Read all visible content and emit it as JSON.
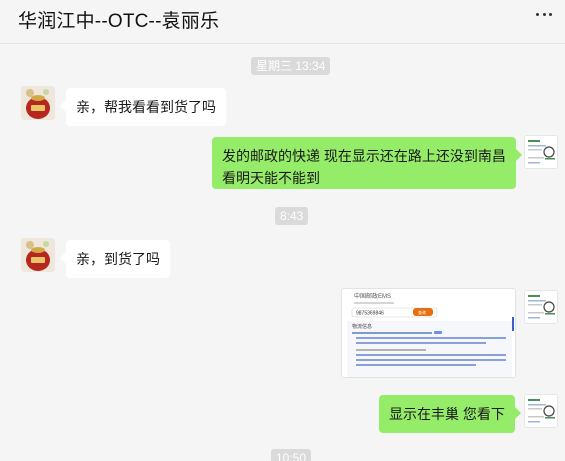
{
  "chat": {
    "title": "华润江中--OTC--袁丽乐"
  },
  "timestamps": [
    "星期三 13:34",
    "8:43",
    "10:50"
  ],
  "messages": [
    {
      "side": "in",
      "text": "亲，帮我看看到货了吗"
    },
    {
      "side": "out",
      "text_line1": "发的邮政的快递 现在显示还在路上还没到南昌",
      "text_line2": "看明天能不能到"
    },
    {
      "side": "in",
      "text": "亲，到货了吗"
    },
    {
      "side": "out",
      "type": "image",
      "image": {
        "brand": "中国邮政EMS",
        "tracking_no": "9875369846",
        "button": "查询",
        "section": "物流信息"
      }
    },
    {
      "side": "out",
      "text": "显示在丰巢 您看下"
    }
  ],
  "icons": {
    "more": "more-icon",
    "avatar_contact": "lucky-bag-avatar",
    "avatar_me": "document-avatar"
  },
  "colors": {
    "background": "#f5f5f5",
    "bubble_out": "#95ec69",
    "bubble_in": "#ffffff",
    "ems_accent": "#e86f10",
    "time_bg": "#dadada"
  }
}
